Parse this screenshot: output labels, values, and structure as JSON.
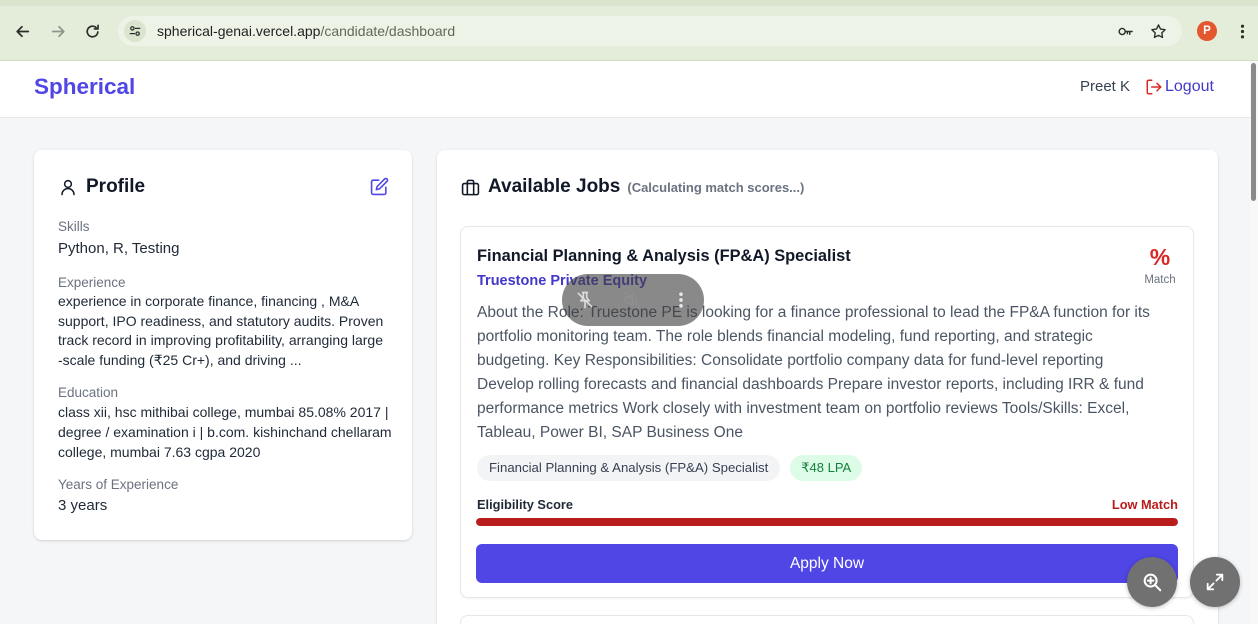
{
  "browser": {
    "url_host": "spherical-genai.vercel.app",
    "url_path": "/candidate/dashboard",
    "profile_initial": "P",
    "icons": [
      "back-arrow-icon",
      "forward-arrow-icon",
      "reload-icon",
      "site-settings-icon",
      "password-key-icon",
      "bookmark-star-icon",
      "browser-menu-icon"
    ]
  },
  "header": {
    "brand": "Spherical",
    "user_name": "Preet K",
    "logout_label": "Logout",
    "logout_icon": "logout-icon"
  },
  "profile": {
    "title": "Profile",
    "title_icon": "user-icon",
    "edit_icon": "edit-icon",
    "skills": {
      "label": "Skills",
      "value": "Python, R, Testing"
    },
    "experience": {
      "label": "Experience",
      "lines": [
        "experience in corporate finance, financing , M&A",
        "support, IPO readiness, and statutory audits. Proven",
        "track record in improving profitability, arranging large",
        "-scale funding (₹25 Cr+), and driving ..."
      ]
    },
    "education": {
      "label": "Education",
      "lines": [
        "class xii, hsc mithibai college, mumbai 85.08% 2017 |",
        "degree / examination i | b.com. kishinchand chellaram",
        "college, mumbai 7.63 cgpa 2020"
      ]
    },
    "years": {
      "label": "Years of Experience",
      "value": "3 years"
    }
  },
  "jobs": {
    "title": "Available Jobs",
    "title_icon": "briefcase-icon",
    "status": "(Calculating match scores...)",
    "items": [
      {
        "title": "Financial Planning & Analysis (FP&A) Specialist",
        "company": "Truestone Private Equity",
        "match_value": "%",
        "match_label": "Match",
        "description_lines": [
          "About the Role: Truestone PE is looking for a finance professional to lead the FP&A function for its",
          "portfolio monitoring team. The role blends financial modeling, fund reporting, and strategic",
          "budgeting. Key Responsibilities: Consolidate portfolio company data for fund-level reporting",
          "Develop rolling forecasts and financial dashboards Prepare investor reports, including IRR & fund",
          "performance metrics Work closely with investment team on portfolio reviews Tools/Skills: Excel,",
          "Tableau, Power BI, SAP Business One"
        ],
        "tags": [
          "Financial Planning & Analysis (FP&A) Specialist"
        ],
        "salary": "₹48 LPA",
        "eligibility_label": "Eligibility Score",
        "eligibility_status": "Low Match",
        "eligibility_percent": 100,
        "apply_label": "Apply Now"
      }
    ]
  },
  "video_overlay": {
    "icons": [
      "pin-off-icon",
      "mute-icon",
      "more-vertical-icon"
    ]
  },
  "floating_controls": {
    "icons": [
      "zoom-in-icon",
      "expand-icon"
    ]
  },
  "colors": {
    "brand": "#4f46e5",
    "match_percent": "#dc2626",
    "low_match": "#b91c1c",
    "salary_bg": "#dcfce7",
    "salary_text": "#15803d",
    "browser_chrome": "#e4ecda",
    "avatar": "#e4572e"
  }
}
